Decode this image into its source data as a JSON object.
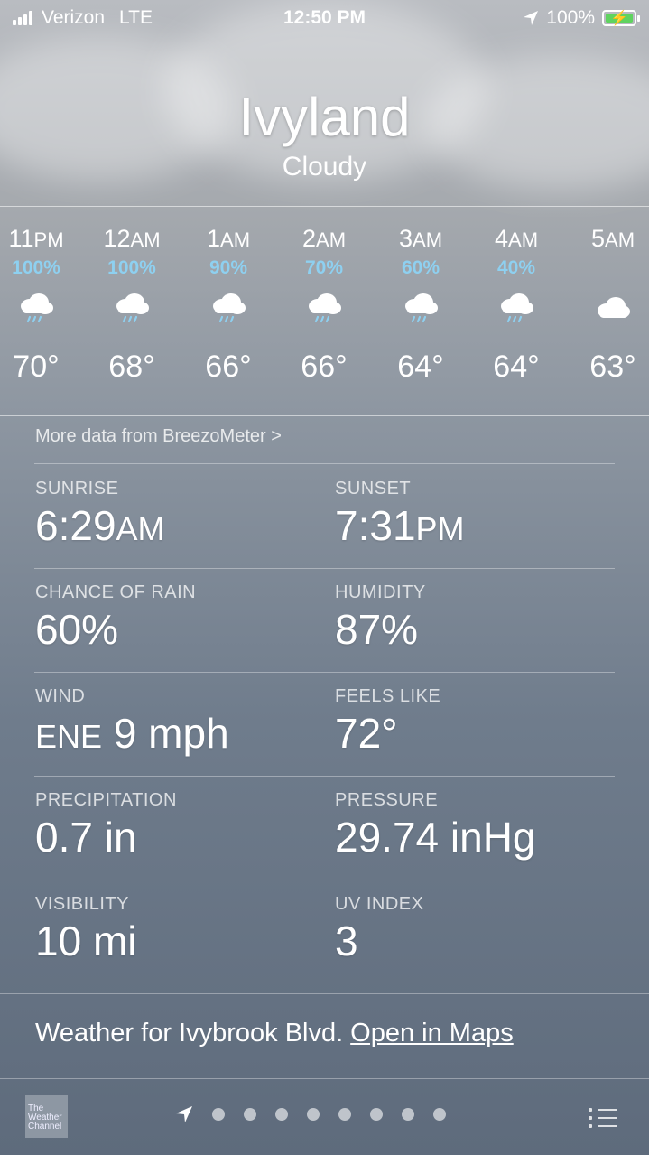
{
  "status_bar": {
    "carrier": "Verizon",
    "network": "LTE",
    "time": "12:50 PM",
    "battery": "100%",
    "icons": [
      "signal-bars-icon",
      "location-arrow-icon",
      "battery-charging-icon"
    ]
  },
  "location": {
    "city": "Ivyland",
    "condition": "Cloudy"
  },
  "hourly": [
    {
      "hour": "11",
      "ampm": "PM",
      "precip": "100%",
      "icon": "rain-cloud-icon",
      "temp": "70°"
    },
    {
      "hour": "12",
      "ampm": "AM",
      "precip": "100%",
      "icon": "rain-cloud-icon",
      "temp": "68°"
    },
    {
      "hour": "1",
      "ampm": "AM",
      "precip": "90%",
      "icon": "rain-cloud-icon",
      "temp": "66°"
    },
    {
      "hour": "2",
      "ampm": "AM",
      "precip": "70%",
      "icon": "rain-cloud-icon",
      "temp": "66°"
    },
    {
      "hour": "3",
      "ampm": "AM",
      "precip": "60%",
      "icon": "rain-cloud-icon",
      "temp": "64°"
    },
    {
      "hour": "4",
      "ampm": "AM",
      "precip": "40%",
      "icon": "rain-cloud-icon",
      "temp": "64°"
    },
    {
      "hour": "5",
      "ampm": "AM",
      "precip": "",
      "icon": "cloud-icon",
      "temp": "63°"
    }
  ],
  "breezometer_link": "More data from BreezoMeter >",
  "details": {
    "sunrise": {
      "label": "SUNRISE",
      "value": "6:29",
      "unit": "AM"
    },
    "sunset": {
      "label": "SUNSET",
      "value": "7:31",
      "unit": "PM"
    },
    "chance_of_rain": {
      "label": "CHANCE OF RAIN",
      "value": "60%"
    },
    "humidity": {
      "label": "HUMIDITY",
      "value": "87%"
    },
    "wind": {
      "label": "WIND",
      "direction": "ENE",
      "value": "9 mph"
    },
    "feels_like": {
      "label": "FEELS LIKE",
      "value": "72°"
    },
    "precipitation": {
      "label": "PRECIPITATION",
      "value": "0.7 in"
    },
    "pressure": {
      "label": "PRESSURE",
      "value": "29.74 inHg"
    },
    "visibility": {
      "label": "VISIBILITY",
      "value": "10 mi"
    },
    "uv_index": {
      "label": "UV INDEX",
      "value": "3"
    }
  },
  "footer": {
    "weather_for": "Weather for Ivybrook Blvd.",
    "open_in_maps": "Open in Maps"
  },
  "bottom_bar": {
    "logo_text": "The Weather Channel",
    "page_dots": 8,
    "active_page": "location-arrow-icon"
  },
  "colors": {
    "precip_blue": "#8ed0f0",
    "battery_green": "#5fd35f"
  }
}
